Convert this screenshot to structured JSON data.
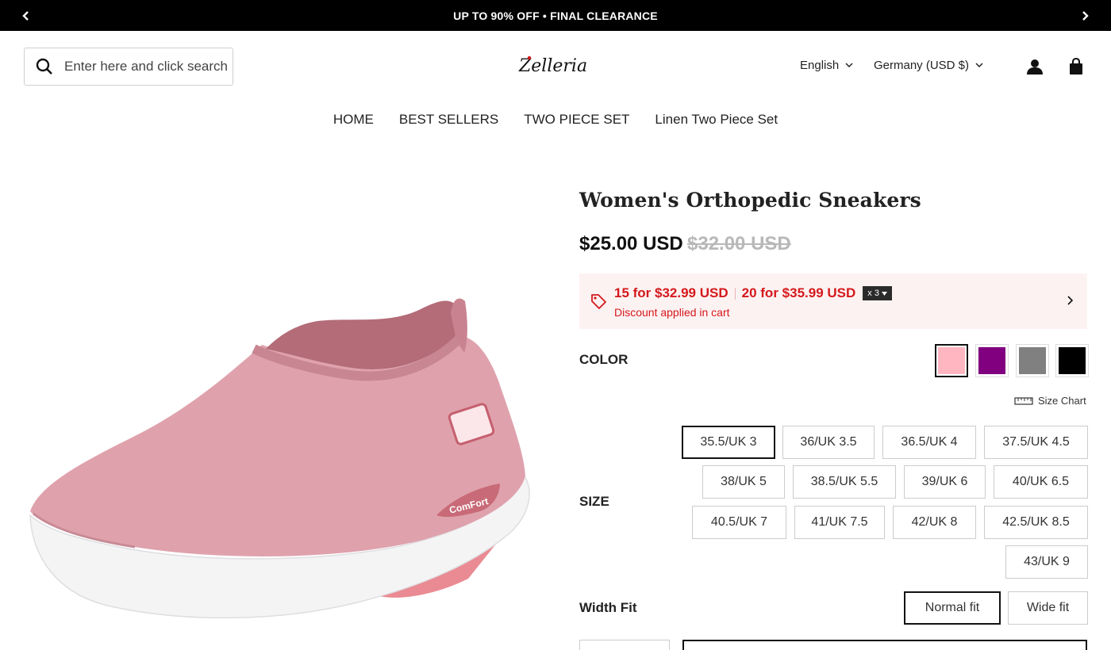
{
  "announcement": {
    "text": "UP TO 90% OFF • FINAL CLEARANCE"
  },
  "header": {
    "search_placeholder": "Enter here and click search",
    "brand": "Zelleria",
    "language": "English",
    "currency": "Germany (USD $)"
  },
  "nav": {
    "items": [
      {
        "label": "HOME"
      },
      {
        "label": "BEST SELLERS"
      },
      {
        "label": "TWO PIECE SET"
      },
      {
        "label": "Linen Two Piece Set"
      }
    ]
  },
  "product": {
    "title": "Women's Orthopedic Sneakers",
    "price": "$25.00 USD",
    "compare_price": "$32.00 USD",
    "image_text": "ComFort"
  },
  "promo": {
    "offer1": "15 for $32.99 USD",
    "offer2": "20 for $35.99 USD",
    "qty_badge": "x 3",
    "note": "Discount applied in cart"
  },
  "options": {
    "color_label": "COLOR",
    "colors": [
      {
        "name": "Pink",
        "hex": "#ffb6c1",
        "selected": true
      },
      {
        "name": "Purple",
        "hex": "#800080",
        "selected": false
      },
      {
        "name": "Gray",
        "hex": "#808080",
        "selected": false
      },
      {
        "name": "Black",
        "hex": "#000000",
        "selected": false
      }
    ],
    "size_chart_label": "Size Chart",
    "size_label": "SIZE",
    "sizes": [
      "35.5/UK 3",
      "36/UK 3.5",
      "36.5/UK 4",
      "37.5/UK 4.5",
      "38/UK 5",
      "38.5/UK 5.5",
      "39/UK 6",
      "40/UK 6.5",
      "40.5/UK 7",
      "41/UK 7.5",
      "42/UK 8",
      "42.5/UK 8.5",
      "43/UK 9"
    ],
    "selected_size": "35.5/UK 3",
    "width_label": "Width Fit",
    "widths": [
      "Normal fit",
      "Wide fit"
    ],
    "selected_width": "Normal fit"
  },
  "colors": {
    "promo_text": "#d4181c",
    "promo_bg": "#fdf2f2",
    "announcement_bg": "#000000"
  }
}
